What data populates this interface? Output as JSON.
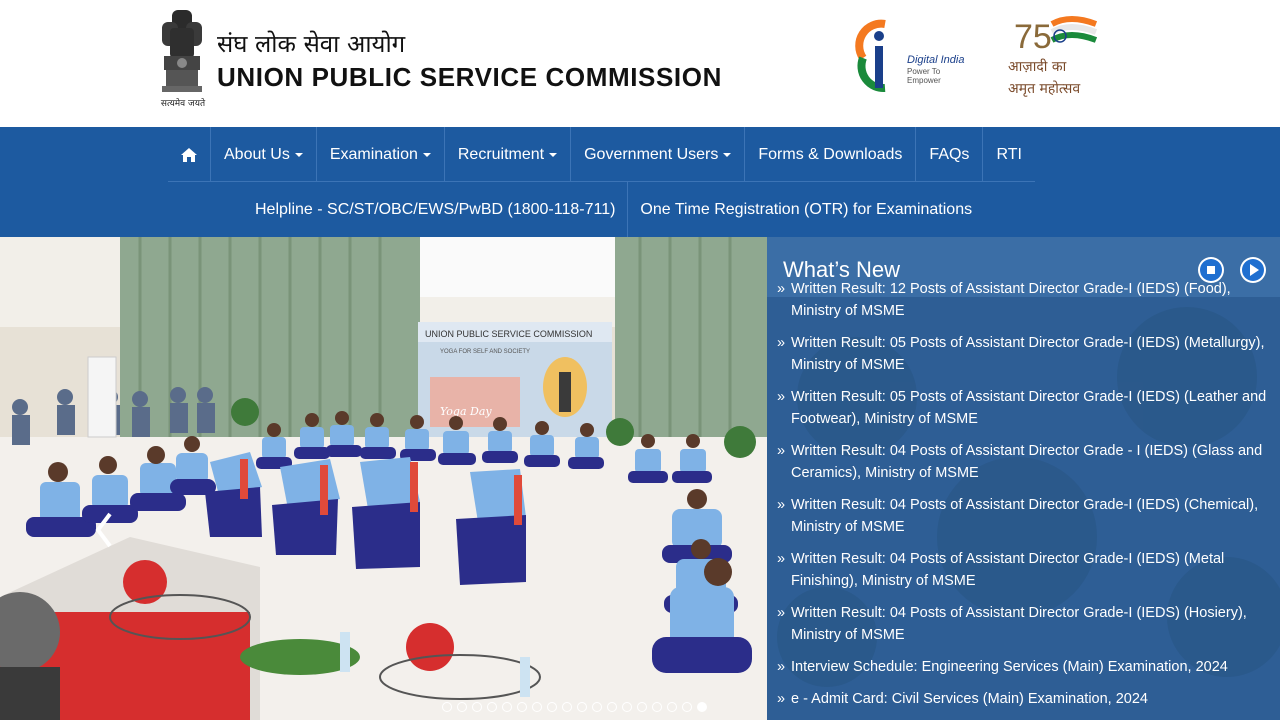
{
  "header": {
    "title_hindi": "संघ लोक सेवा आयोग",
    "title_english": "UNION PUBLIC SERVICE COMMISSION",
    "emblem_motto": "सत्यमेव जयते",
    "digital_india_title": "Digital India",
    "digital_india_sub": "Power To Empower",
    "azadi_line1": "आज़ादी का",
    "azadi_line2": "अमृत महोत्सव",
    "azadi_number": "75"
  },
  "nav": {
    "home_icon": "home-icon",
    "row1": [
      {
        "label": "About Us",
        "dropdown": true
      },
      {
        "label": "Examination",
        "dropdown": true
      },
      {
        "label": "Recruitment",
        "dropdown": true
      },
      {
        "label": "Government Users",
        "dropdown": true
      },
      {
        "label": "Forms & Downloads",
        "dropdown": false
      },
      {
        "label": "FAQs",
        "dropdown": false
      },
      {
        "label": "RTI",
        "dropdown": false
      }
    ],
    "row2": [
      {
        "label": "Helpline - SC/ST/OBC/EWS/PwBD (1800-118-711)"
      },
      {
        "label": "One Time Registration (OTR) for Examinations"
      }
    ]
  },
  "carousel": {
    "prev_icon": "chevron-left-icon",
    "banner_text": "UNION PUBLIC SERVICE COMMISSION",
    "banner_sub": "YOGA FOR SELF AND SOCIETY",
    "banner_event": "Yoga Day",
    "dot_count": 18,
    "active_dot": 18
  },
  "whats_new": {
    "title": "What’s New",
    "stop_icon": "stop-icon",
    "play_icon": "play-icon",
    "bullet": "»",
    "items": [
      "Written Result: 12 Posts of Assistant Director Grade-I (IEDS) (Food), Ministry of MSME",
      "Written Result: 05 Posts of Assistant Director Grade-I (IEDS) (Metallurgy), Ministry of MSME",
      "Written Result: 05 Posts of Assistant Director Grade-I (IEDS) (Leather and Footwear), Ministry of MSME",
      "Written Result: 04 Posts of Assistant Director Grade - I (IEDS) (Glass and Ceramics), Ministry of MSME",
      "Written Result: 04 Posts of Assistant Director Grade-I (IEDS) (Chemical), Ministry of MSME",
      "Written Result: 04 Posts of Assistant Director Grade-I (IEDS) (Metal Finishing), Ministry of MSME",
      "Written Result: 04 Posts of Assistant Director Grade-I (IEDS) (Hosiery), Ministry of MSME",
      "Interview Schedule: Engineering Services (Main) Examination, 2024",
      "e - Admit Card: Civil Services (Main) Examination, 2024"
    ]
  },
  "colors": {
    "nav_bg": "#1d5aa0",
    "news_bg": "#2f5f96",
    "control_blue": "#1f6fd0"
  }
}
